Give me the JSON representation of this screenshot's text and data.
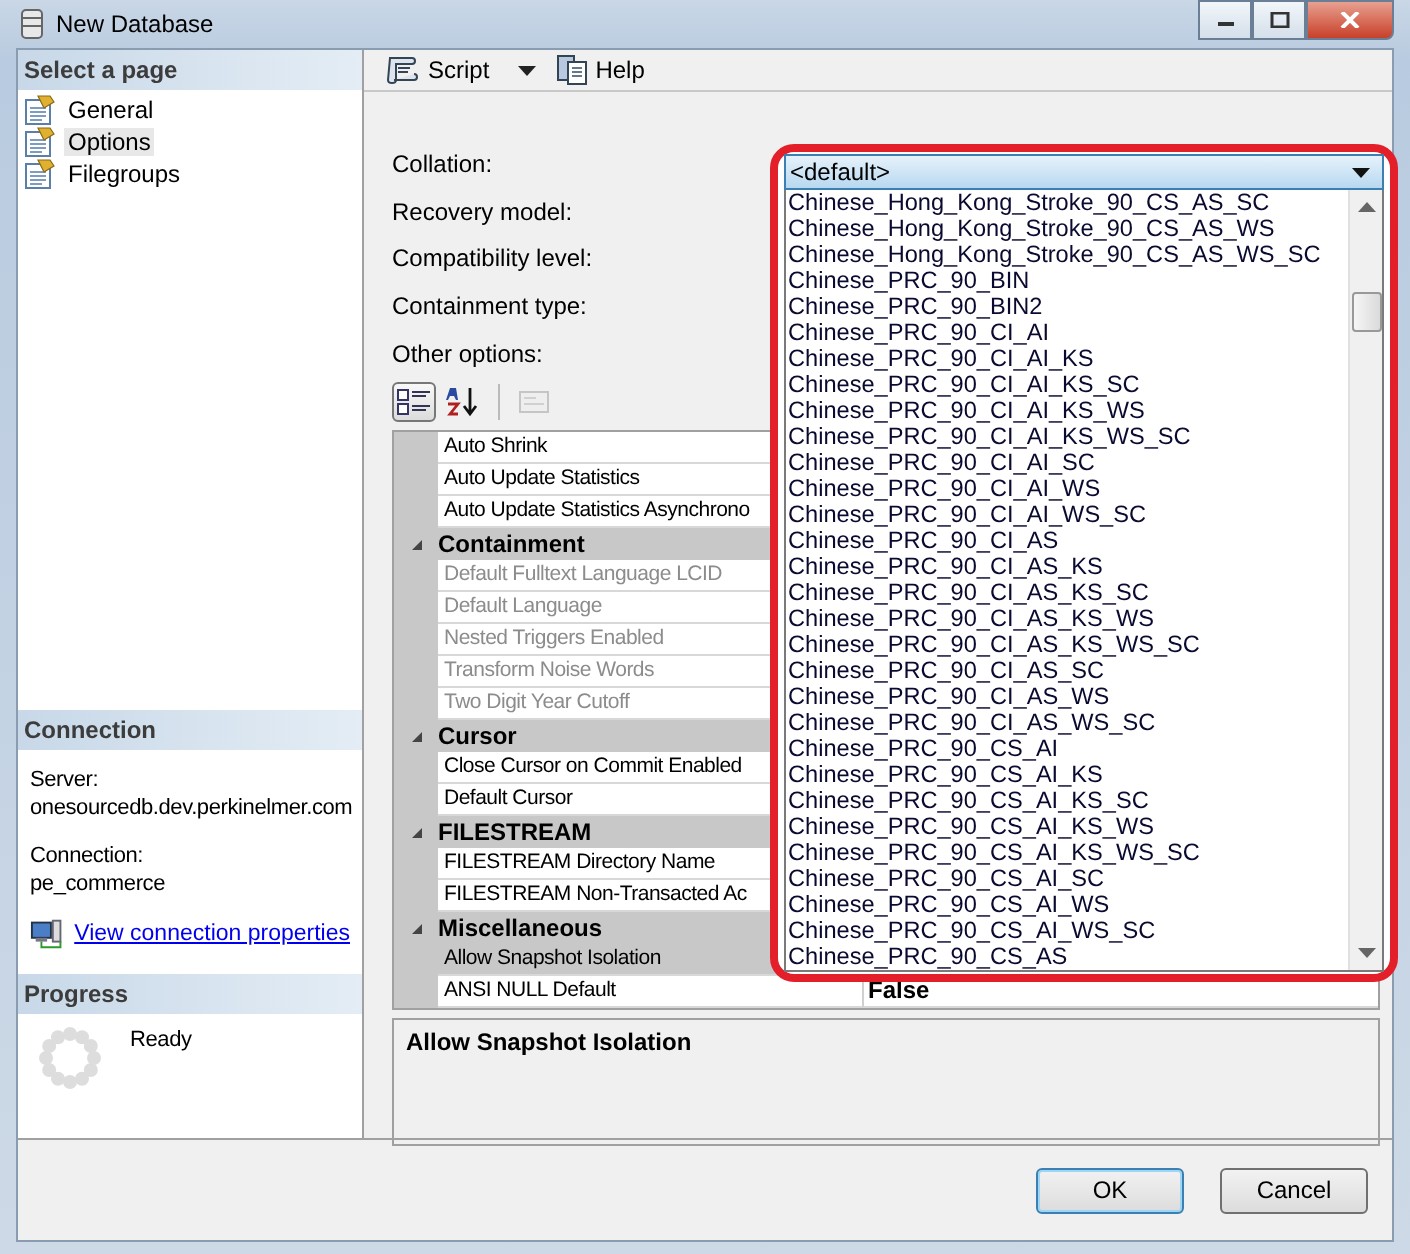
{
  "window": {
    "title": "New Database"
  },
  "sidebar": {
    "header": "Select a page",
    "items": [
      {
        "label": "General",
        "selected": false
      },
      {
        "label": "Options",
        "selected": true
      },
      {
        "label": "Filegroups",
        "selected": false
      }
    ]
  },
  "connection": {
    "header": "Connection",
    "server_label": "Server:",
    "server": "onesourcedb.dev.perkinelmer.com",
    "connection_label": "Connection:",
    "connection": "pe_commerce",
    "link": "View connection properties"
  },
  "progress": {
    "header": "Progress",
    "status": "Ready"
  },
  "toolbar": {
    "script": "Script",
    "help": "Help"
  },
  "form": {
    "labels": [
      "Collation:",
      "Recovery model:",
      "Compatibility level:",
      "Containment type:"
    ],
    "other_options": "Other options:"
  },
  "grid_toolbar": [
    {
      "kind": "categorized",
      "selected": true
    },
    {
      "kind": "alphabetical",
      "selected": false
    },
    {
      "kind": "pages",
      "selected": false,
      "disabled": true
    }
  ],
  "property_grid": [
    {
      "kind": "property",
      "label": "Auto Shrink",
      "disabled": false,
      "selected": false
    },
    {
      "kind": "property",
      "label": "Auto Update Statistics",
      "disabled": false,
      "selected": false
    },
    {
      "kind": "property",
      "label": "Auto Update Statistics Asynchrono",
      "disabled": false,
      "selected": false
    },
    {
      "kind": "category",
      "label": "Containment",
      "expanded": true
    },
    {
      "kind": "property",
      "label": "Default Fulltext Language LCID",
      "disabled": true,
      "selected": false
    },
    {
      "kind": "property",
      "label": "Default Language",
      "disabled": true,
      "selected": false
    },
    {
      "kind": "property",
      "label": "Nested Triggers Enabled",
      "disabled": true,
      "selected": false
    },
    {
      "kind": "property",
      "label": "Transform Noise Words",
      "disabled": true,
      "selected": false
    },
    {
      "kind": "property",
      "label": "Two Digit Year Cutoff",
      "disabled": true,
      "selected": false
    },
    {
      "kind": "category",
      "label": "Cursor",
      "expanded": true
    },
    {
      "kind": "property",
      "label": "Close Cursor on Commit Enabled",
      "disabled": false,
      "selected": false
    },
    {
      "kind": "property",
      "label": "Default Cursor",
      "disabled": false,
      "selected": false
    },
    {
      "kind": "category",
      "label": "FILESTREAM",
      "expanded": true
    },
    {
      "kind": "property",
      "label": "FILESTREAM Directory Name",
      "disabled": false,
      "selected": false
    },
    {
      "kind": "property",
      "label": "FILESTREAM Non-Transacted Ac",
      "disabled": false,
      "selected": false
    },
    {
      "kind": "category",
      "label": "Miscellaneous",
      "expanded": true
    },
    {
      "kind": "property",
      "label": "Allow Snapshot Isolation",
      "disabled": false,
      "selected": true
    },
    {
      "kind": "property",
      "label": "ANSI NULL Default",
      "disabled": false,
      "selected": false,
      "value": "False"
    }
  ],
  "description": "Allow Snapshot Isolation",
  "collation_dropdown": {
    "value": "<default>",
    "options": [
      "Chinese_Hong_Kong_Stroke_90_CS_AS_SC",
      "Chinese_Hong_Kong_Stroke_90_CS_AS_WS",
      "Chinese_Hong_Kong_Stroke_90_CS_AS_WS_SC",
      "Chinese_PRC_90_BIN",
      "Chinese_PRC_90_BIN2",
      "Chinese_PRC_90_CI_AI",
      "Chinese_PRC_90_CI_AI_KS",
      "Chinese_PRC_90_CI_AI_KS_SC",
      "Chinese_PRC_90_CI_AI_KS_WS",
      "Chinese_PRC_90_CI_AI_KS_WS_SC",
      "Chinese_PRC_90_CI_AI_SC",
      "Chinese_PRC_90_CI_AI_WS",
      "Chinese_PRC_90_CI_AI_WS_SC",
      "Chinese_PRC_90_CI_AS",
      "Chinese_PRC_90_CI_AS_KS",
      "Chinese_PRC_90_CI_AS_KS_SC",
      "Chinese_PRC_90_CI_AS_KS_WS",
      "Chinese_PRC_90_CI_AS_KS_WS_SC",
      "Chinese_PRC_90_CI_AS_SC",
      "Chinese_PRC_90_CI_AS_WS",
      "Chinese_PRC_90_CI_AS_WS_SC",
      "Chinese_PRC_90_CS_AI",
      "Chinese_PRC_90_CS_AI_KS",
      "Chinese_PRC_90_CS_AI_KS_SC",
      "Chinese_PRC_90_CS_AI_KS_WS",
      "Chinese_PRC_90_CS_AI_KS_WS_SC",
      "Chinese_PRC_90_CS_AI_SC",
      "Chinese_PRC_90_CS_AI_WS",
      "Chinese_PRC_90_CS_AI_WS_SC",
      "Chinese_PRC_90_CS_AS"
    ]
  },
  "buttons": [
    {
      "label": "OK",
      "kind": "default"
    },
    {
      "label": "Cancel",
      "kind": "normal"
    }
  ]
}
